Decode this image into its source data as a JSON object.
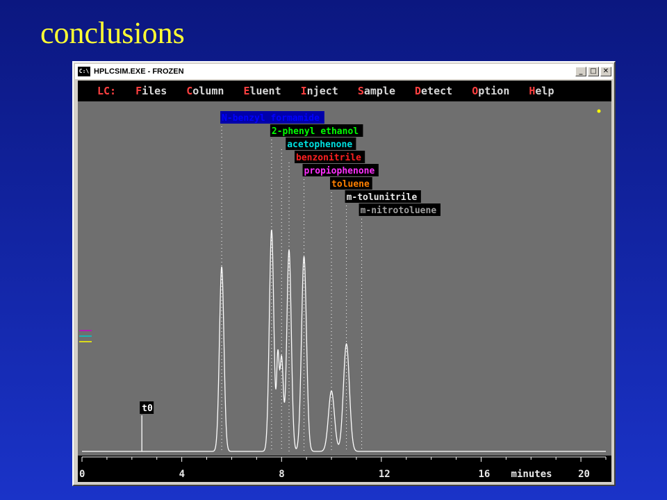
{
  "slide": {
    "title": "conclusions"
  },
  "window": {
    "title": "HPLCSIM.EXE - FROZEN",
    "icon_text": "C:\\",
    "controls": {
      "minimize": "_",
      "maximize": "□",
      "close": "✕"
    }
  },
  "menu": [
    {
      "hotkey": "LC:",
      "rest": ""
    },
    {
      "hotkey": "F",
      "rest": "iles"
    },
    {
      "hotkey": "C",
      "rest": "olumn"
    },
    {
      "hotkey": "E",
      "rest": "luent"
    },
    {
      "hotkey": "I",
      "rest": "nject"
    },
    {
      "hotkey": "S",
      "rest": "ample"
    },
    {
      "hotkey": "D",
      "rest": "etect"
    },
    {
      "hotkey": "O",
      "rest": "ption"
    },
    {
      "hotkey": "H",
      "rest": "elp"
    }
  ],
  "chart_data": {
    "type": "line",
    "xlabel": "minutes",
    "xlim": [
      0,
      21
    ],
    "x_ticks": [
      "0",
      "4",
      "8",
      "12",
      "16",
      "20"
    ],
    "t0": {
      "label": "t0",
      "x": 2.4
    },
    "peaks": [
      {
        "name": "N-benzyl formamide",
        "rt": 5.6,
        "height": 0.55,
        "width": 0.09,
        "color": "#0000cc",
        "text_color": "#0000ff",
        "label_bg": "#0000aa"
      },
      {
        "name": "2-phenyl ethanol",
        "rt": 7.6,
        "height": 0.66,
        "width": 0.09,
        "color": "#00cc00",
        "text_color": "#00ff00",
        "label_bg": "#000000"
      },
      {
        "name": "acetophenone",
        "rt": 8.0,
        "height": 0.28,
        "width": 0.07,
        "color": "#00cccc",
        "text_color": "#00e0e0",
        "label_bg": "#000000"
      },
      {
        "name": "benzonitrile",
        "rt": 8.3,
        "height": 0.6,
        "width": 0.09,
        "color": "#cc0000",
        "text_color": "#ff2020",
        "label_bg": "#000000"
      },
      {
        "name": "propiophenone",
        "rt": 8.9,
        "height": 0.58,
        "width": 0.1,
        "color": "#cc00cc",
        "text_color": "#ff30ff",
        "label_bg": "#000000"
      },
      {
        "name": "toluene",
        "rt": 10.0,
        "height": 0.18,
        "width": 0.12,
        "color": "#cc6600",
        "text_color": "#ff8000",
        "label_bg": "#000000"
      },
      {
        "name": "m-tolunitrile",
        "rt": 10.6,
        "height": 0.32,
        "width": 0.12,
        "color": "#cccccc",
        "text_color": "#e8e8e8",
        "label_bg": "#000000"
      },
      {
        "name": "m-nitrotoluene",
        "rt": 10.6,
        "height": 0.32,
        "width": 0.12,
        "color": "#808080",
        "text_color": "#a0a0a0",
        "label_bg": "#000000"
      }
    ],
    "colors": {
      "plot_bg": "#6f6f6f",
      "trace": "#ffffff",
      "axis_bg": "#000000"
    }
  }
}
